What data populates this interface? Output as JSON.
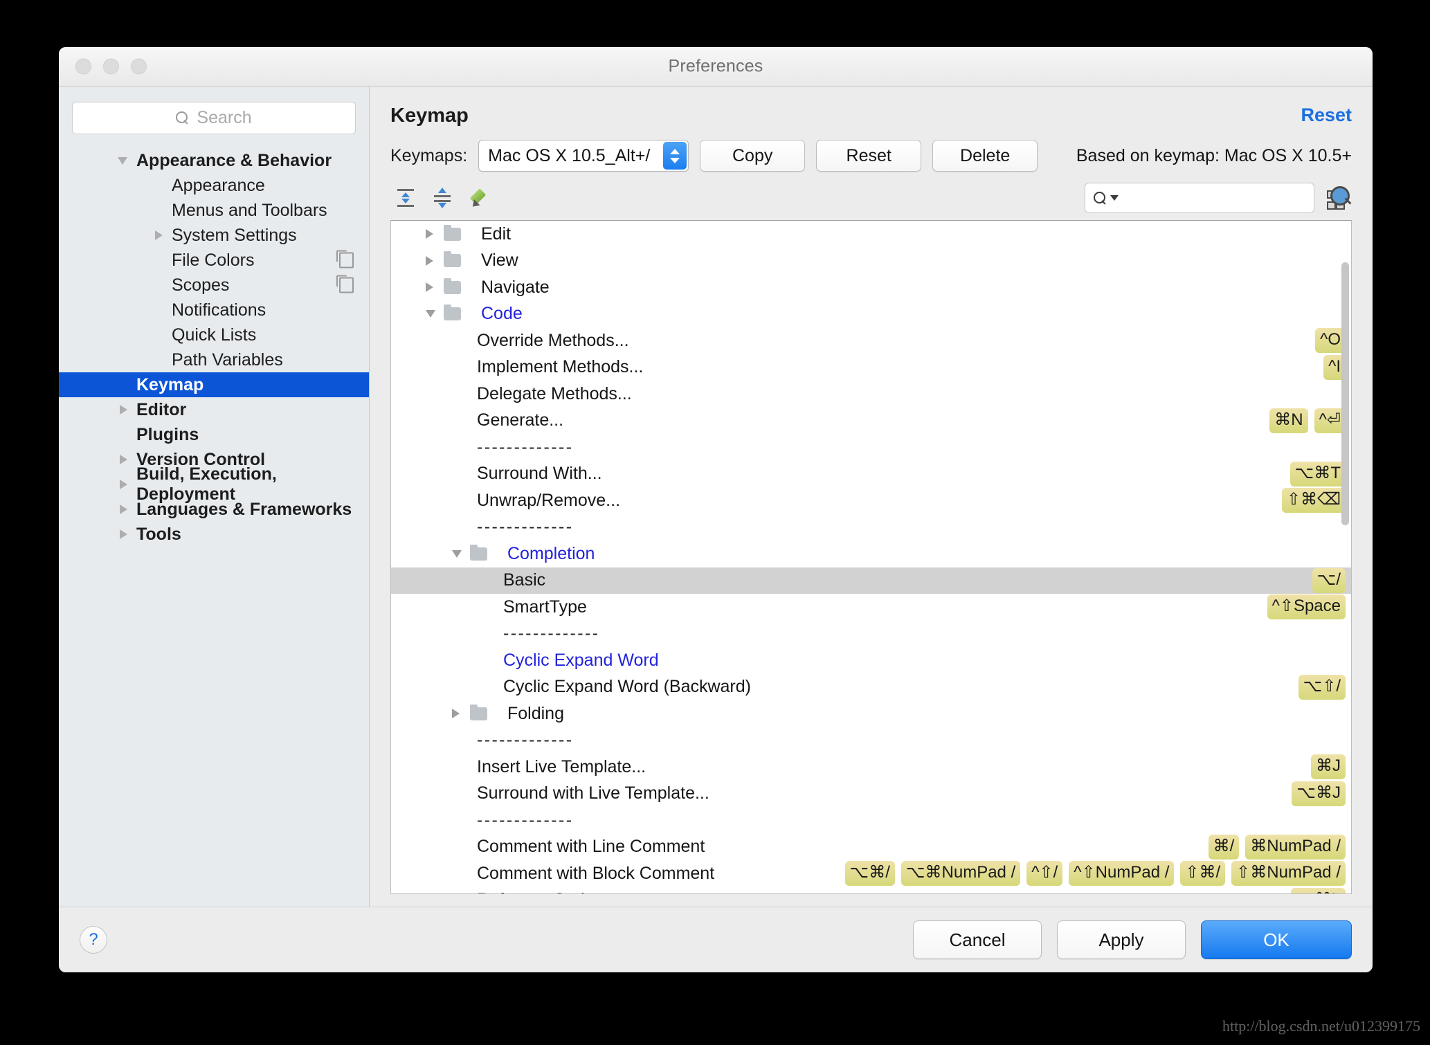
{
  "window": {
    "title": "Preferences"
  },
  "sidebar": {
    "search_placeholder": "Search",
    "items": [
      {
        "label": "Appearance & Behavior",
        "level": 0,
        "twisty": "down",
        "selected": false,
        "badge": false
      },
      {
        "label": "Appearance",
        "level": 1,
        "twisty": "none",
        "selected": false,
        "badge": false
      },
      {
        "label": "Menus and Toolbars",
        "level": 1,
        "twisty": "none",
        "selected": false,
        "badge": false
      },
      {
        "label": "System Settings",
        "level": 1,
        "twisty": "right",
        "selected": false,
        "badge": false
      },
      {
        "label": "File Colors",
        "level": 1,
        "twisty": "none",
        "selected": false,
        "badge": true
      },
      {
        "label": "Scopes",
        "level": 1,
        "twisty": "none",
        "selected": false,
        "badge": true
      },
      {
        "label": "Notifications",
        "level": 1,
        "twisty": "none",
        "selected": false,
        "badge": false
      },
      {
        "label": "Quick Lists",
        "level": 1,
        "twisty": "none",
        "selected": false,
        "badge": false
      },
      {
        "label": "Path Variables",
        "level": 1,
        "twisty": "none",
        "selected": false,
        "badge": false
      },
      {
        "label": "Keymap",
        "level": 0,
        "twisty": "none",
        "selected": true,
        "badge": false
      },
      {
        "label": "Editor",
        "level": 0,
        "twisty": "right",
        "selected": false,
        "badge": false
      },
      {
        "label": "Plugins",
        "level": 0,
        "twisty": "none",
        "selected": false,
        "badge": false
      },
      {
        "label": "Version Control",
        "level": 0,
        "twisty": "right",
        "selected": false,
        "badge": false
      },
      {
        "label": "Build, Execution, Deployment",
        "level": 0,
        "twisty": "right",
        "selected": false,
        "badge": false
      },
      {
        "label": "Languages & Frameworks",
        "level": 0,
        "twisty": "right",
        "selected": false,
        "badge": false
      },
      {
        "label": "Tools",
        "level": 0,
        "twisty": "right",
        "selected": false,
        "badge": false
      }
    ]
  },
  "main": {
    "page_title": "Keymap",
    "reset_link": "Reset",
    "keymaps_label": "Keymaps:",
    "keymap_selected": "Mac OS X 10.5_Alt+/",
    "copy_button": "Copy",
    "reset_button": "Reset",
    "delete_button": "Delete",
    "based_on": "Based on keymap: Mac OS X 10.5+",
    "tree_search_value": "",
    "toolbar_icons": [
      "expand-all-icon",
      "collapse-all-icon",
      "edit-pencil-icon"
    ],
    "find_shortcut_icon": "find-by-shortcut-icon"
  },
  "tree": {
    "rows": [
      {
        "kind": "folder",
        "indent": 1,
        "twisty": "right",
        "label": "Edit",
        "open": false,
        "shortcuts": []
      },
      {
        "kind": "folder",
        "indent": 1,
        "twisty": "right",
        "label": "View",
        "open": false,
        "shortcuts": []
      },
      {
        "kind": "folder",
        "indent": 1,
        "twisty": "right",
        "label": "Navigate",
        "open": false,
        "shortcuts": []
      },
      {
        "kind": "folder",
        "indent": 1,
        "twisty": "down",
        "label": "Code",
        "open": true,
        "shortcuts": []
      },
      {
        "kind": "action",
        "indent": 2,
        "label": "Override Methods...",
        "blue": false,
        "shortcuts": [
          "^O"
        ]
      },
      {
        "kind": "action",
        "indent": 2,
        "label": "Implement Methods...",
        "blue": false,
        "shortcuts": [
          "^I"
        ]
      },
      {
        "kind": "action",
        "indent": 2,
        "label": "Delegate Methods...",
        "blue": false,
        "shortcuts": []
      },
      {
        "kind": "action",
        "indent": 2,
        "label": "Generate...",
        "blue": false,
        "shortcuts": [
          "⌘N",
          "^⏎"
        ]
      },
      {
        "kind": "sep",
        "indent": 2,
        "label": "-------------",
        "shortcuts": []
      },
      {
        "kind": "action",
        "indent": 2,
        "label": "Surround With...",
        "blue": false,
        "shortcuts": [
          "⌥⌘T"
        ]
      },
      {
        "kind": "action",
        "indent": 2,
        "label": "Unwrap/Remove...",
        "blue": false,
        "shortcuts": [
          "⇧⌘⌫"
        ]
      },
      {
        "kind": "sep",
        "indent": 2,
        "label": "-------------",
        "shortcuts": []
      },
      {
        "kind": "folder",
        "indent": 2,
        "twisty": "down",
        "label": "Completion",
        "open": true,
        "shortcuts": []
      },
      {
        "kind": "action",
        "indent": 3,
        "label": "Basic",
        "blue": false,
        "selected": true,
        "shortcuts": [
          "⌥/"
        ]
      },
      {
        "kind": "action",
        "indent": 3,
        "label": "SmartType",
        "blue": false,
        "shortcuts": [
          "^⇧Space"
        ]
      },
      {
        "kind": "sep",
        "indent": 3,
        "label": "-------------",
        "shortcuts": []
      },
      {
        "kind": "action",
        "indent": 3,
        "label": "Cyclic Expand Word",
        "blue": true,
        "shortcuts": []
      },
      {
        "kind": "action",
        "indent": 3,
        "label": "Cyclic Expand Word (Backward)",
        "blue": false,
        "shortcuts": [
          "⌥⇧/"
        ]
      },
      {
        "kind": "folder",
        "indent": 2,
        "twisty": "right",
        "label": "Folding",
        "open": false,
        "shortcuts": []
      },
      {
        "kind": "sep",
        "indent": 2,
        "label": "-------------",
        "shortcuts": []
      },
      {
        "kind": "action",
        "indent": 2,
        "label": "Insert Live Template...",
        "blue": false,
        "shortcuts": [
          "⌘J"
        ]
      },
      {
        "kind": "action",
        "indent": 2,
        "label": "Surround with Live Template...",
        "blue": false,
        "shortcuts": [
          "⌥⌘J"
        ]
      },
      {
        "kind": "sep",
        "indent": 2,
        "label": "-------------",
        "shortcuts": []
      },
      {
        "kind": "action",
        "indent": 2,
        "label": "Comment with Line Comment",
        "blue": false,
        "shortcuts": [
          "⌘/",
          "⌘NumPad /"
        ]
      },
      {
        "kind": "action",
        "indent": 2,
        "label": "Comment with Block Comment",
        "blue": false,
        "shortcuts": [
          "⌥⌘/",
          "⌥⌘NumPad /",
          "^⇧/",
          "^⇧NumPad /",
          "⇧⌘/",
          "⇧⌘NumPad /"
        ]
      },
      {
        "kind": "action",
        "indent": 2,
        "label": "Reformat Code",
        "blue": false,
        "shortcuts": [
          "⌥⌘L"
        ]
      }
    ]
  },
  "footer": {
    "help_label": "?",
    "cancel_label": "Cancel",
    "apply_label": "Apply",
    "ok_label": "OK"
  },
  "watermark": {
    "line1": "http://blog.csdn.net/u012399175",
    "line2": "http://blog.csdn.net/u012399175"
  },
  "colors": {
    "accent": "#0b55d6",
    "link": "#1b6fe0",
    "shortcut_badge": "#d6d87a",
    "tree_link": "#2222dd",
    "selection_row": "#d2d2d2"
  }
}
